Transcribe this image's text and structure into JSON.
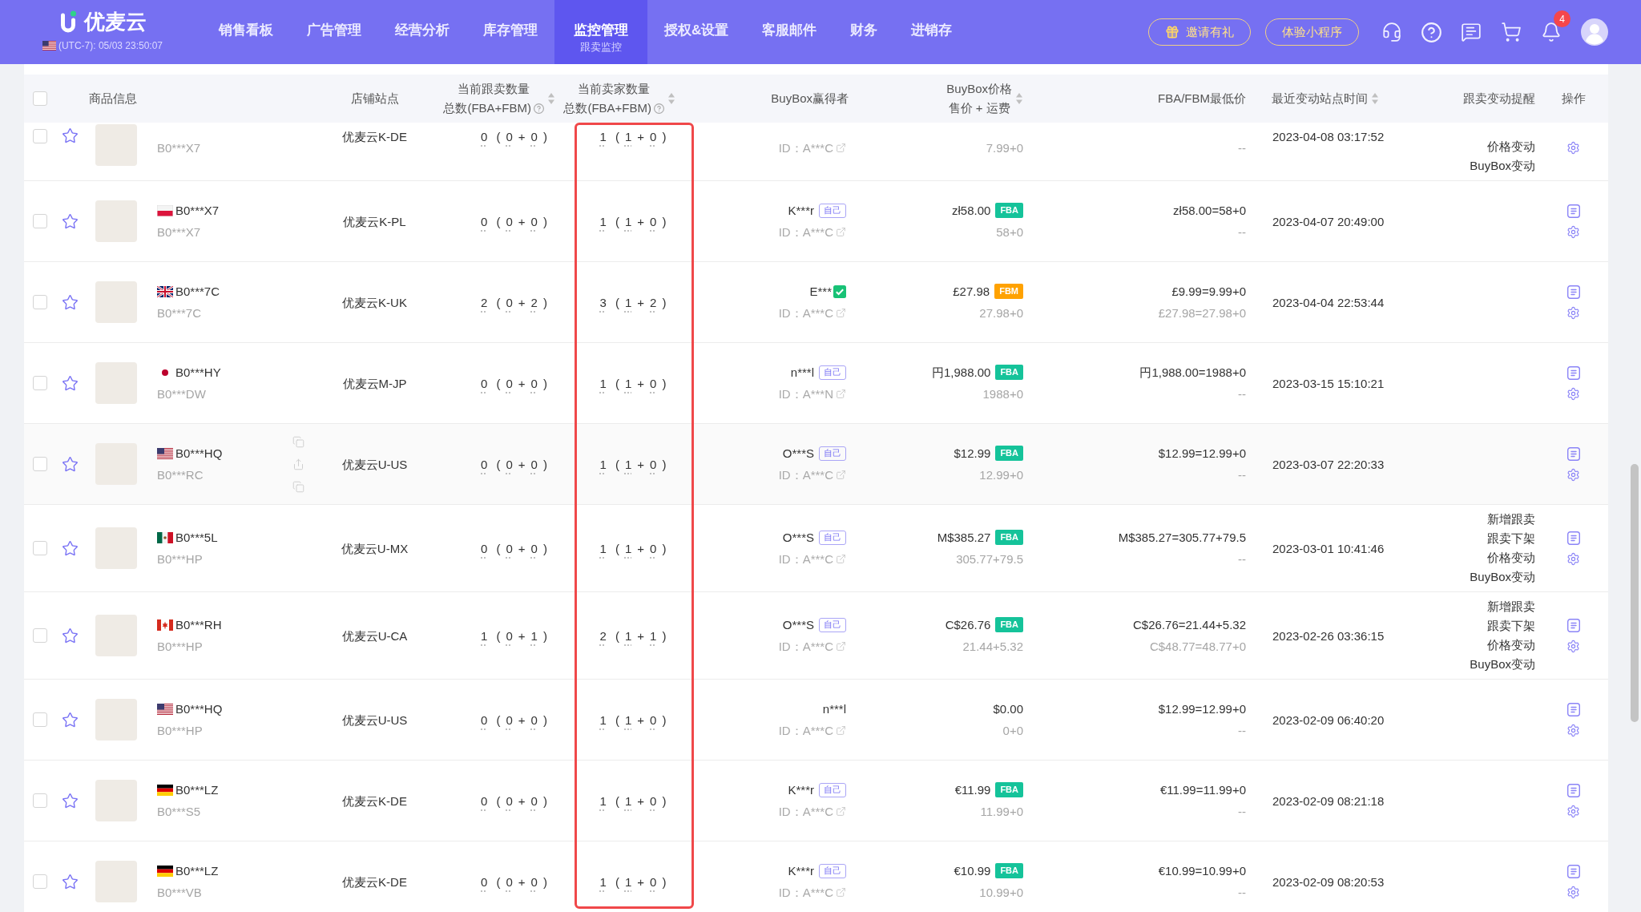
{
  "topbar": {
    "logo": "优麦云",
    "timezone": {
      "flag": {
        "kind": "us"
      },
      "text": "(UTC-7): 05/03 23:50:07"
    },
    "nav": [
      {
        "label": "销售看板",
        "selected": false
      },
      {
        "label": "广告管理",
        "selected": false
      },
      {
        "label": "经营分析",
        "selected": false
      },
      {
        "label": "库存管理",
        "selected": false
      },
      {
        "label": "监控管理",
        "sublabel": "跟卖监控",
        "selected": true
      },
      {
        "label": "授权&设置",
        "selected": false
      },
      {
        "label": "客服邮件",
        "selected": false
      },
      {
        "label": "财务",
        "selected": false
      },
      {
        "label": "进销存",
        "selected": false
      }
    ],
    "buttons": [
      {
        "label": "邀请有礼",
        "with_icon": true
      },
      {
        "label": "体验小程序",
        "with_icon": false
      }
    ],
    "notification_count": "4"
  },
  "table": {
    "select_all": {
      "checked": false
    },
    "columns": [
      {
        "label": "商品信息",
        "help": false,
        "sortable": false,
        "highlighted": false
      },
      {
        "label": "店铺站点",
        "help": false,
        "sortable": false,
        "highlighted": false
      },
      {
        "label": "当前跟卖数量",
        "sublabel": "总数(FBA+FBM)",
        "help": true,
        "sortable": true,
        "highlighted": false
      },
      {
        "label": "当前卖家数量",
        "sublabel": "总数(FBA+FBM)",
        "help": true,
        "sortable": true,
        "highlighted": true
      },
      {
        "label": "BuyBox赢得者",
        "help": false,
        "sortable": false,
        "highlighted": false
      },
      {
        "label": "BuyBox价格",
        "sublabel": "售价 + 运费",
        "help": false,
        "sortable": true,
        "highlighted": false
      },
      {
        "label": "FBA/FBM最低价",
        "help": false,
        "sortable": false,
        "highlighted": false
      },
      {
        "label": "最近变动站点时间",
        "help": false,
        "sortable": true,
        "highlighted": false
      },
      {
        "label": "跟卖变动提醒",
        "help": false,
        "sortable": false,
        "highlighted": false
      },
      {
        "label": "操作",
        "help": false,
        "sortable": false,
        "highlighted": false
      }
    ],
    "rows": [
      {
        "checked": false,
        "starred": false,
        "hovered": false,
        "clipped": true,
        "parent_asin": "B0***X7",
        "store": "优麦云K-DE",
        "follow": [
          "0",
          "(",
          "0",
          "+",
          "0",
          ")"
        ],
        "sellers": [
          "1",
          "(",
          "1",
          "+",
          "0",
          ")"
        ],
        "winner": {
          "id": "ID：A***C"
        },
        "price": {
          "detail": "7.99+0"
        },
        "lowest": {
          "detail": "--"
        },
        "time": "2023-04-08 03:17:52",
        "reminders": [
          "价格变动",
          "BuyBox变动"
        ]
      },
      {
        "checked": false,
        "starred": false,
        "hovered": false,
        "clipped": false,
        "flag": {
          "kind": "pl"
        },
        "asin": "B0***X7",
        "parent_asin": "B0***X7",
        "store": "优麦云K-PL",
        "follow": [
          "0",
          "(",
          "0",
          "+",
          "0",
          ")"
        ],
        "sellers": [
          "1",
          "(",
          "1",
          "+",
          "0",
          ")"
        ],
        "winner": {
          "name": "K***r",
          "tag": "自己",
          "checked": false,
          "id": "ID：A***C"
        },
        "price": {
          "value": "zł58.00",
          "tag": {
            "label": "FBA",
            "color": "#15c39a"
          },
          "detail": "58+0"
        },
        "lowest": {
          "main": "zł58.00=58+0",
          "detail": "--"
        },
        "time": "2023-04-07 20:49:00"
      },
      {
        "checked": false,
        "starred": false,
        "hovered": false,
        "clipped": false,
        "flag": {
          "kind": "gb"
        },
        "asin": "B0***7C",
        "parent_asin": "B0***7C",
        "store": "优麦云K-UK",
        "follow": [
          "2",
          "(",
          "0",
          "+",
          "2",
          ")"
        ],
        "sellers": [
          "3",
          "(",
          "1",
          "+",
          "2",
          ")"
        ],
        "winner": {
          "name": "E***",
          "checked": true,
          "id": "ID：A***C"
        },
        "price": {
          "value": "£27.98",
          "tag": {
            "label": "FBM",
            "color": "#ffa200"
          },
          "detail": "27.98+0"
        },
        "lowest": {
          "main": "£9.99=9.99+0",
          "detail": "£27.98=27.98+0"
        },
        "time": "2023-04-04 22:53:44"
      },
      {
        "checked": false,
        "starred": false,
        "hovered": false,
        "clipped": false,
        "flag": {
          "kind": "jp"
        },
        "asin": "B0***HY",
        "parent_asin": "B0***DW",
        "store": "优麦云M-JP",
        "follow": [
          "0",
          "(",
          "0",
          "+",
          "0",
          ")"
        ],
        "sellers": [
          "1",
          "(",
          "1",
          "+",
          "0",
          ")"
        ],
        "winner": {
          "name": "n***l",
          "tag": "自己",
          "checked": false,
          "id": "ID：A***N"
        },
        "price": {
          "value": "円1,988.00",
          "tag": {
            "label": "FBA",
            "color": "#15c39a"
          },
          "detail": "1988+0"
        },
        "lowest": {
          "main": "円1,988.00=1988+0",
          "detail": "--"
        },
        "time": "2023-03-15 15:10:21"
      },
      {
        "checked": false,
        "starred": false,
        "hovered": true,
        "clipped": false,
        "flag": {
          "kind": "us"
        },
        "asin": "B0***HQ",
        "parent_asin": "B0***RC",
        "store": "优麦云U-US",
        "follow": [
          "0",
          "(",
          "0",
          "+",
          "0",
          ")"
        ],
        "sellers": [
          "1",
          "(",
          "1",
          "+",
          "0",
          ")"
        ],
        "winner": {
          "name": "O***S",
          "tag": "自己",
          "checked": false,
          "id": "ID：A***C"
        },
        "price": {
          "value": "$12.99",
          "tag": {
            "label": "FBA",
            "color": "#15c39a"
          },
          "detail": "12.99+0"
        },
        "lowest": {
          "main": "$12.99=12.99+0",
          "detail": "--"
        },
        "time": "2023-03-07 22:20:33"
      },
      {
        "checked": false,
        "starred": false,
        "hovered": false,
        "clipped": false,
        "flag": {
          "kind": "mx"
        },
        "asin": "B0***5L",
        "parent_asin": "B0***HP",
        "store": "优麦云U-MX",
        "follow": [
          "0",
          "(",
          "0",
          "+",
          "0",
          ")"
        ],
        "sellers": [
          "1",
          "(",
          "1",
          "+",
          "0",
          ")"
        ],
        "winner": {
          "name": "O***S",
          "tag": "自己",
          "checked": false,
          "id": "ID：A***C"
        },
        "price": {
          "value": "M$385.27",
          "tag": {
            "label": "FBA",
            "color": "#15c39a"
          },
          "detail": "305.77+79.5"
        },
        "lowest": {
          "main": "M$385.27=305.77+79.5",
          "detail": "--"
        },
        "time": "2023-03-01 10:41:46",
        "reminders": [
          "新增跟卖",
          "跟卖下架",
          "价格变动",
          "BuyBox变动"
        ]
      },
      {
        "checked": false,
        "starred": false,
        "hovered": false,
        "clipped": false,
        "flag": {
          "kind": "ca"
        },
        "asin": "B0***RH",
        "parent_asin": "B0***HP",
        "store": "优麦云U-CA",
        "follow": [
          "1",
          "(",
          "0",
          "+",
          "1",
          ")"
        ],
        "sellers": [
          "2",
          "(",
          "1",
          "+",
          "1",
          ")"
        ],
        "winner": {
          "name": "O***S",
          "tag": "自己",
          "checked": false,
          "id": "ID：A***C"
        },
        "price": {
          "value": "C$26.76",
          "tag": {
            "label": "FBA",
            "color": "#15c39a"
          },
          "detail": "21.44+5.32"
        },
        "lowest": {
          "main": "C$26.76=21.44+5.32",
          "detail": "C$48.77=48.77+0"
        },
        "time": "2023-02-26 03:36:15",
        "reminders": [
          "新增跟卖",
          "跟卖下架",
          "价格变动",
          "BuyBox变动"
        ]
      },
      {
        "checked": false,
        "starred": false,
        "hovered": false,
        "clipped": false,
        "flag": {
          "kind": "us"
        },
        "asin": "B0***HQ",
        "parent_asin": "B0***HP",
        "store": "优麦云U-US",
        "follow": [
          "0",
          "(",
          "0",
          "+",
          "0",
          ")"
        ],
        "sellers": [
          "1",
          "(",
          "1",
          "+",
          "0",
          ")"
        ],
        "winner": {
          "name": "n***l",
          "checked": false,
          "id": "ID：A***C"
        },
        "price": {
          "value": "$0.00",
          "detail": "0+0"
        },
        "lowest": {
          "main": "$12.99=12.99+0",
          "detail": "--"
        },
        "time": "2023-02-09 06:40:20"
      },
      {
        "checked": false,
        "starred": false,
        "hovered": false,
        "clipped": false,
        "flag": {
          "kind": "de"
        },
        "asin": "B0***LZ",
        "parent_asin": "B0***S5",
        "store": "优麦云K-DE",
        "follow": [
          "0",
          "(",
          "0",
          "+",
          "0",
          ")"
        ],
        "sellers": [
          "1",
          "(",
          "1",
          "+",
          "0",
          ")"
        ],
        "winner": {
          "name": "K***r",
          "tag": "自己",
          "checked": false,
          "id": "ID：A***C"
        },
        "price": {
          "value": "€11.99",
          "tag": {
            "label": "FBA",
            "color": "#15c39a"
          },
          "detail": "11.99+0"
        },
        "lowest": {
          "main": "€11.99=11.99+0",
          "detail": "--"
        },
        "time": "2023-02-09 08:21:18"
      },
      {
        "checked": false,
        "starred": false,
        "hovered": false,
        "clipped": false,
        "flag": {
          "kind": "de"
        },
        "asin": "B0***LZ",
        "parent_asin": "B0***VB",
        "store": "优麦云K-DE",
        "follow": [
          "0",
          "(",
          "0",
          "+",
          "0",
          ")"
        ],
        "sellers": [
          "1",
          "(",
          "1",
          "+",
          "0",
          ")"
        ],
        "winner": {
          "name": "K***r",
          "tag": "自己",
          "checked": false,
          "id": "ID：A***C"
        },
        "price": {
          "value": "€10.99",
          "tag": {
            "label": "FBA",
            "color": "#15c39a"
          },
          "detail": "10.99+0"
        },
        "lowest": {
          "main": "€10.99=10.99+0",
          "detail": "--"
        },
        "time": "2023-02-09 08:20:53"
      }
    ]
  }
}
